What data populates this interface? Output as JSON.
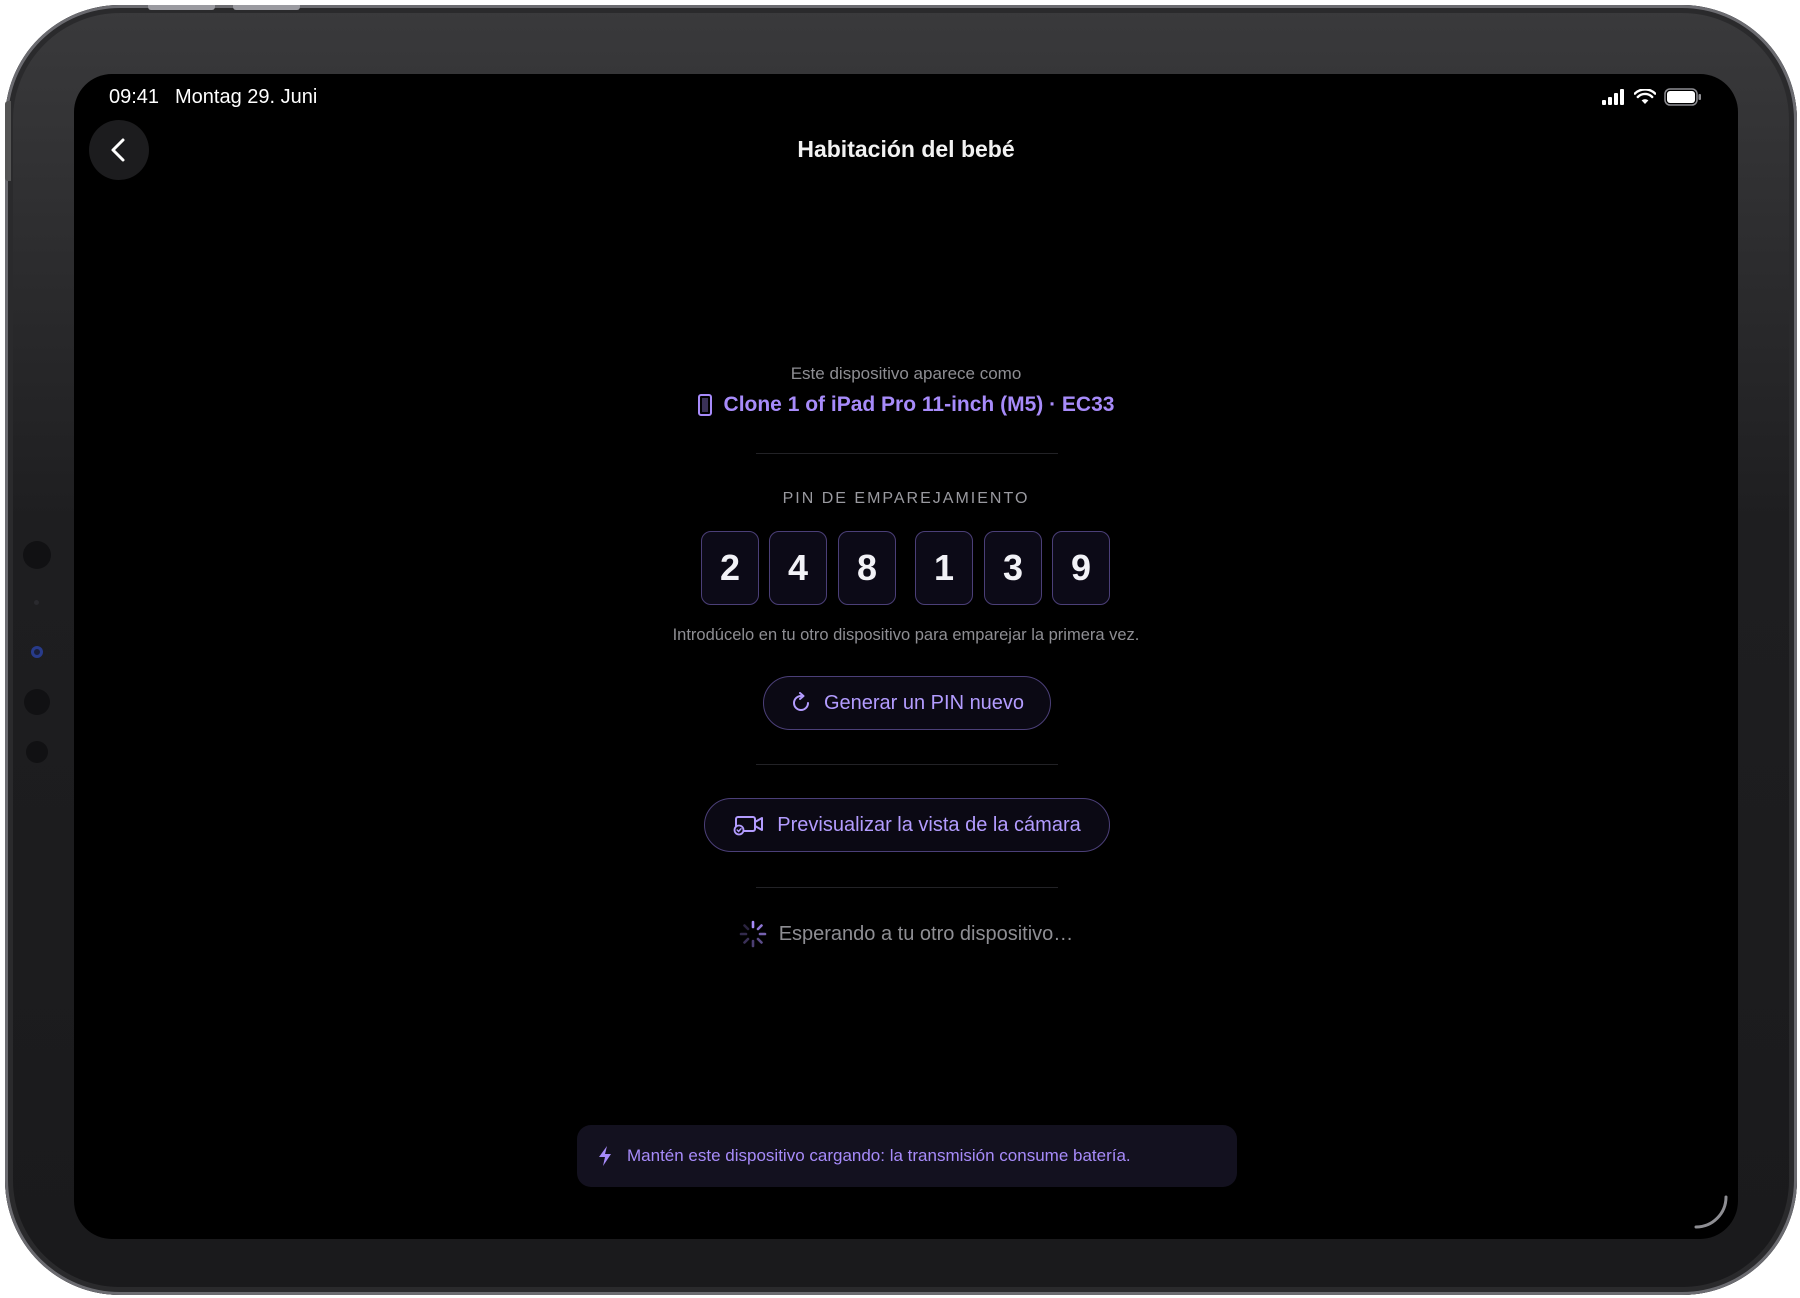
{
  "status_bar": {
    "time": "09:41",
    "date": "Montag 29. Juni"
  },
  "nav": {
    "title": "Habitación del bebé",
    "back_icon": "chevron-left-icon"
  },
  "device_info": {
    "caption": "Este dispositivo aparece como",
    "name": "Clone 1 of iPad Pro 11-inch (M5) · EC33",
    "icon": "ipad-icon"
  },
  "pin": {
    "label": "PIN DE EMPAREJAMIENTO",
    "digits": [
      "2",
      "4",
      "8",
      "1",
      "3",
      "9"
    ],
    "hint": "Introdúcelo en tu otro dispositivo para emparejar la primera vez."
  },
  "actions": {
    "regenerate_label": "Generar un PIN nuevo",
    "regenerate_icon": "refresh-icon",
    "preview_label": "Previsualizar la vista de la cámara",
    "preview_icon": "camera-preview-icon"
  },
  "waiting": {
    "text": "Esperando a tu otro dispositivo…",
    "icon": "spinner-icon"
  },
  "banner": {
    "text": "Mantén este dispositivo cargando: la transmisión consume batería.",
    "icon": "bolt-icon"
  },
  "colors": {
    "accent": "#a78bfa",
    "background": "#000000",
    "muted_text": "#8e8e93"
  }
}
